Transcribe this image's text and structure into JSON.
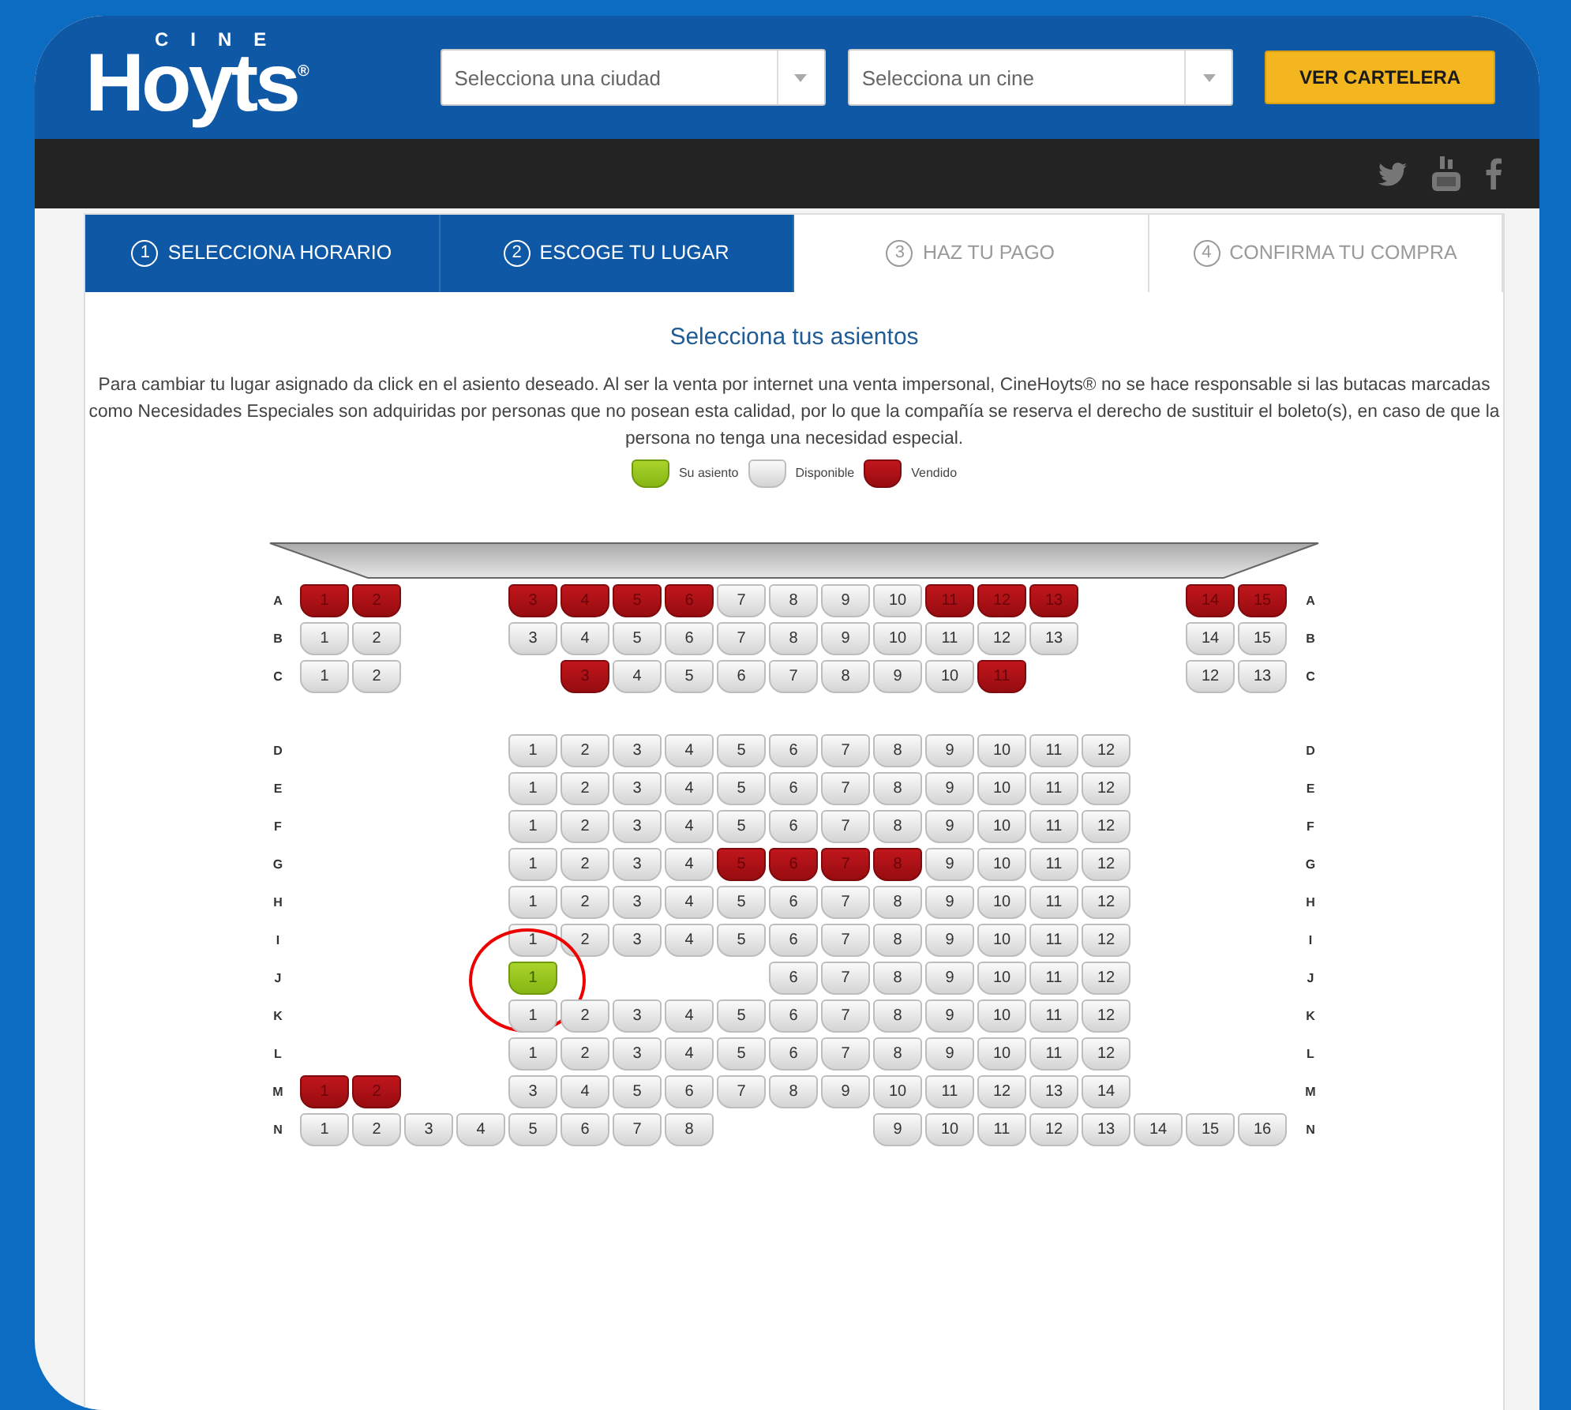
{
  "header": {
    "logo_small": "CINE",
    "logo": "Hoyts$^{®}$",
    "city_select": {
      "placeholder": "Selecciona una ciudad"
    },
    "cinema_select": {
      "placeholder": "Selecciona un cine"
    },
    "button": "VER CARTELERA"
  },
  "steps": [
    {
      "number": "1",
      "label": "SELECCIONA HORARIO",
      "disabled": false
    },
    {
      "number": "2",
      "label": "ESCOGE TU LUGAR",
      "disabled": false
    },
    {
      "number": "3",
      "label": "HAZ TU PAGO",
      "disabled": true
    },
    {
      "number": "4",
      "label": "CONFIRMA TU COMPRA",
      "disabled": true
    }
  ],
  "title": "Selecciona tus asientos",
  "notice": "Para cambiar tu lugar asignado da click en el asiento deseado. Al ser la venta por internet una venta impersonal, CineHoyts® no se hace responsable si las butacas marcadas como Necesidades Especiales son adquiridas por personas que no posean esta calidad, por lo que la compañía se reserva el derecho de sustituir el boleto(s), en caso de que la persona no tenga una necesidad especial.",
  "legend": [
    {
      "kind": "yours",
      "label": "Su asiento"
    },
    {
      "kind": "available",
      "label": "Disponible"
    },
    {
      "kind": "sold",
      "label": "Vendido"
    }
  ],
  "sections": [
    {
      "rows": [
        {
          "label_left": "A",
          "label_right": "A",
          "seats": [
            {
              "number": "1",
              "kind": "sold"
            },
            {
              "number": "2",
              "kind": "sold"
            },
            {
              "kind": "aisle"
            },
            {
              "kind": "aisle"
            },
            {
              "number": "3",
              "kind": "sold"
            },
            {
              "number": "4",
              "kind": "sold"
            },
            {
              "number": "5",
              "kind": "sold"
            },
            {
              "number": "6",
              "kind": "sold"
            },
            {
              "number": "7",
              "kind": "available"
            },
            {
              "number": "8",
              "kind": "available"
            },
            {
              "number": "9",
              "kind": "available"
            },
            {
              "number": "10",
              "kind": "available"
            },
            {
              "number": "11",
              "kind": "sold"
            },
            {
              "number": "12",
              "kind": "sold"
            },
            {
              "number": "13",
              "kind": "sold"
            },
            {
              "kind": "aisle"
            },
            {
              "kind": "aisle"
            },
            {
              "number": "14",
              "kind": "sold"
            },
            {
              "number": "15",
              "kind": "sold"
            }
          ]
        },
        {
          "label_left": "B",
          "label_right": "B",
          "seats": [
            {
              "number": "1",
              "kind": "available"
            },
            {
              "number": "2",
              "kind": "available"
            },
            {
              "kind": "aisle"
            },
            {
              "kind": "aisle"
            },
            {
              "number": "3",
              "kind": "available"
            },
            {
              "number": "4",
              "kind": "available"
            },
            {
              "number": "5",
              "kind": "available"
            },
            {
              "number": "6",
              "kind": "available"
            },
            {
              "number": "7",
              "kind": "available"
            },
            {
              "number": "8",
              "kind": "available"
            },
            {
              "number": "9",
              "kind": "available"
            },
            {
              "number": "10",
              "kind": "available"
            },
            {
              "number": "11",
              "kind": "available"
            },
            {
              "number": "12",
              "kind": "available"
            },
            {
              "number": "13",
              "kind": "available"
            },
            {
              "kind": "aisle"
            },
            {
              "kind": "aisle"
            },
            {
              "number": "14",
              "kind": "available"
            },
            {
              "number": "15",
              "kind": "available"
            }
          ]
        },
        {
          "label_left": "C",
          "label_right": "C",
          "seats": [
            {
              "number": "1",
              "kind": "available"
            },
            {
              "number": "2",
              "kind": "available"
            },
            {
              "kind": "aisle"
            },
            {
              "kind": "aisle"
            },
            {
              "kind": "aisle"
            },
            {
              "number": "3",
              "kind": "sold"
            },
            {
              "number": "4",
              "kind": "available"
            },
            {
              "number": "5",
              "kind": "available"
            },
            {
              "number": "6",
              "kind": "available"
            },
            {
              "number": "7",
              "kind": "available"
            },
            {
              "number": "8",
              "kind": "available"
            },
            {
              "number": "9",
              "kind": "available"
            },
            {
              "number": "10",
              "kind": "available"
            },
            {
              "number": "11",
              "kind": "sold"
            },
            {
              "kind": "aisle"
            },
            {
              "kind": "aisle"
            },
            {
              "kind": "aisle"
            },
            {
              "number": "12",
              "kind": "available"
            },
            {
              "number": "13",
              "kind": "available"
            }
          ]
        }
      ]
    },
    {
      "rows": [
        {
          "label_left": "D",
          "label_right": "D",
          "seats": [
            {
              "kind": "aisle"
            },
            {
              "kind": "aisle"
            },
            {
              "kind": "aisle"
            },
            {
              "kind": "aisle"
            },
            {
              "number": "1",
              "kind": "available"
            },
            {
              "number": "2",
              "kind": "available"
            },
            {
              "number": "3",
              "kind": "available"
            },
            {
              "number": "4",
              "kind": "available"
            },
            {
              "number": "5",
              "kind": "available"
            },
            {
              "number": "6",
              "kind": "available"
            },
            {
              "number": "7",
              "kind": "available"
            },
            {
              "number": "8",
              "kind": "available"
            },
            {
              "number": "9",
              "kind": "available"
            },
            {
              "number": "10",
              "kind": "available"
            },
            {
              "number": "11",
              "kind": "available"
            },
            {
              "number": "12",
              "kind": "available"
            }
          ]
        },
        {
          "label_left": "E",
          "label_right": "E",
          "seats": [
            {
              "kind": "aisle"
            },
            {
              "kind": "aisle"
            },
            {
              "kind": "aisle"
            },
            {
              "kind": "aisle"
            },
            {
              "number": "1",
              "kind": "available"
            },
            {
              "number": "2",
              "kind": "available"
            },
            {
              "number": "3",
              "kind": "available"
            },
            {
              "number": "4",
              "kind": "available"
            },
            {
              "number": "5",
              "kind": "available"
            },
            {
              "number": "6",
              "kind": "available"
            },
            {
              "number": "7",
              "kind": "available"
            },
            {
              "number": "8",
              "kind": "available"
            },
            {
              "number": "9",
              "kind": "available"
            },
            {
              "number": "10",
              "kind": "available"
            },
            {
              "number": "11",
              "kind": "available"
            },
            {
              "number": "12",
              "kind": "available"
            }
          ]
        },
        {
          "label_left": "F",
          "label_right": "F",
          "seats": [
            {
              "kind": "aisle"
            },
            {
              "kind": "aisle"
            },
            {
              "kind": "aisle"
            },
            {
              "kind": "aisle"
            },
            {
              "number": "1",
              "kind": "available"
            },
            {
              "number": "2",
              "kind": "available"
            },
            {
              "number": "3",
              "kind": "available"
            },
            {
              "number": "4",
              "kind": "available"
            },
            {
              "number": "5",
              "kind": "available"
            },
            {
              "number": "6",
              "kind": "available"
            },
            {
              "number": "7",
              "kind": "available"
            },
            {
              "number": "8",
              "kind": "available"
            },
            {
              "number": "9",
              "kind": "available"
            },
            {
              "number": "10",
              "kind": "available"
            },
            {
              "number": "11",
              "kind": "available"
            },
            {
              "number": "12",
              "kind": "available"
            }
          ]
        },
        {
          "label_left": "G",
          "label_right": "G",
          "seats": [
            {
              "kind": "aisle"
            },
            {
              "kind": "aisle"
            },
            {
              "kind": "aisle"
            },
            {
              "kind": "aisle"
            },
            {
              "number": "1",
              "kind": "available"
            },
            {
              "number": "2",
              "kind": "available"
            },
            {
              "number": "3",
              "kind": "available"
            },
            {
              "number": "4",
              "kind": "available"
            },
            {
              "number": "5",
              "kind": "sold"
            },
            {
              "number": "6",
              "kind": "sold"
            },
            {
              "number": "7",
              "kind": "sold"
            },
            {
              "number": "8",
              "kind": "sold"
            },
            {
              "number": "9",
              "kind": "available"
            },
            {
              "number": "10",
              "kind": "available"
            },
            {
              "number": "11",
              "kind": "available"
            },
            {
              "number": "12",
              "kind": "available"
            }
          ]
        },
        {
          "label_left": "H",
          "label_right": "H",
          "seats": [
            {
              "kind": "aisle"
            },
            {
              "kind": "aisle"
            },
            {
              "kind": "aisle"
            },
            {
              "kind": "aisle"
            },
            {
              "number": "1",
              "kind": "available"
            },
            {
              "number": "2",
              "kind": "available"
            },
            {
              "number": "3",
              "kind": "available"
            },
            {
              "number": "4",
              "kind": "available"
            },
            {
              "number": "5",
              "kind": "available"
            },
            {
              "number": "6",
              "kind": "available"
            },
            {
              "number": "7",
              "kind": "available"
            },
            {
              "number": "8",
              "kind": "available"
            },
            {
              "number": "9",
              "kind": "available"
            },
            {
              "number": "10",
              "kind": "available"
            },
            {
              "number": "11",
              "kind": "available"
            },
            {
              "number": "12",
              "kind": "available"
            }
          ]
        },
        {
          "label_left": "I",
          "label_right": "I",
          "seats": [
            {
              "kind": "aisle"
            },
            {
              "kind": "aisle"
            },
            {
              "kind": "aisle"
            },
            {
              "kind": "aisle"
            },
            {
              "number": "1",
              "kind": "available"
            },
            {
              "number": "2",
              "kind": "available"
            },
            {
              "number": "3",
              "kind": "available"
            },
            {
              "number": "4",
              "kind": "available"
            },
            {
              "number": "5",
              "kind": "available"
            },
            {
              "number": "6",
              "kind": "available"
            },
            {
              "number": "7",
              "kind": "available"
            },
            {
              "number": "8",
              "kind": "available"
            },
            {
              "number": "9",
              "kind": "available"
            },
            {
              "number": "10",
              "kind": "available"
            },
            {
              "number": "11",
              "kind": "available"
            },
            {
              "number": "12",
              "kind": "available"
            }
          ]
        },
        {
          "label_left": "J",
          "label_right": "J",
          "seats": [
            {
              "kind": "aisle"
            },
            {
              "kind": "aisle"
            },
            {
              "kind": "aisle"
            },
            {
              "kind": "aisle"
            },
            {
              "number": "1",
              "kind": "yours",
              "circled": true
            },
            {
              "kind": "aisle"
            },
            {
              "kind": "aisle"
            },
            {
              "kind": "aisle"
            },
            {
              "kind": "aisle"
            },
            {
              "number": "6",
              "kind": "available"
            },
            {
              "number": "7",
              "kind": "available"
            },
            {
              "number": "8",
              "kind": "available"
            },
            {
              "number": "9",
              "kind": "available"
            },
            {
              "number": "10",
              "kind": "available"
            },
            {
              "number": "11",
              "kind": "available"
            },
            {
              "number": "12",
              "kind": "available"
            }
          ]
        },
        {
          "label_left": "K",
          "label_right": "K",
          "seats": [
            {
              "kind": "aisle"
            },
            {
              "kind": "aisle"
            },
            {
              "kind": "aisle"
            },
            {
              "kind": "aisle"
            },
            {
              "number": "1",
              "kind": "available"
            },
            {
              "number": "2",
              "kind": "available"
            },
            {
              "number": "3",
              "kind": "available"
            },
            {
              "number": "4",
              "kind": "available"
            },
            {
              "number": "5",
              "kind": "available"
            },
            {
              "number": "6",
              "kind": "available"
            },
            {
              "number": "7",
              "kind": "available"
            },
            {
              "number": "8",
              "kind": "available"
            },
            {
              "number": "9",
              "kind": "available"
            },
            {
              "number": "10",
              "kind": "available"
            },
            {
              "number": "11",
              "kind": "available"
            },
            {
              "number": "12",
              "kind": "available"
            }
          ]
        },
        {
          "label_left": "L",
          "label_right": "L",
          "seats": [
            {
              "kind": "aisle"
            },
            {
              "kind": "aisle"
            },
            {
              "kind": "aisle"
            },
            {
              "kind": "aisle"
            },
            {
              "number": "1",
              "kind": "available"
            },
            {
              "number": "2",
              "kind": "available"
            },
            {
              "number": "3",
              "kind": "available"
            },
            {
              "number": "4",
              "kind": "available"
            },
            {
              "number": "5",
              "kind": "available"
            },
            {
              "number": "6",
              "kind": "available"
            },
            {
              "number": "7",
              "kind": "available"
            },
            {
              "number": "8",
              "kind": "available"
            },
            {
              "number": "9",
              "kind": "available"
            },
            {
              "number": "10",
              "kind": "available"
            },
            {
              "number": "11",
              "kind": "available"
            },
            {
              "number": "12",
              "kind": "available"
            }
          ]
        },
        {
          "label_left": "M",
          "label_right": "M",
          "seats": [
            {
              "number": "1",
              "kind": "sold"
            },
            {
              "number": "2",
              "kind": "sold"
            },
            {
              "kind": "aisle"
            },
            {
              "kind": "aisle"
            },
            {
              "number": "3",
              "kind": "available"
            },
            {
              "number": "4",
              "kind": "available"
            },
            {
              "number": "5",
              "kind": "available"
            },
            {
              "number": "6",
              "kind": "available"
            },
            {
              "number": "7",
              "kind": "available"
            },
            {
              "number": "8",
              "kind": "available"
            },
            {
              "number": "9",
              "kind": "available"
            },
            {
              "number": "10",
              "kind": "available"
            },
            {
              "number": "11",
              "kind": "available"
            },
            {
              "number": "12",
              "kind": "available"
            },
            {
              "number": "13",
              "kind": "available"
            },
            {
              "number": "14",
              "kind": "available"
            }
          ]
        },
        {
          "label_left": "N",
          "label_right": "N",
          "seats": [
            {
              "number": "1",
              "kind": "available"
            },
            {
              "number": "2",
              "kind": "available"
            },
            {
              "number": "3",
              "kind": "available"
            },
            {
              "number": "4",
              "kind": "available"
            },
            {
              "number": "5",
              "kind": "available"
            },
            {
              "number": "6",
              "kind": "available"
            },
            {
              "number": "7",
              "kind": "available"
            },
            {
              "number": "8",
              "kind": "available"
            },
            {
              "kind": "aisle"
            },
            {
              "kind": "aisle"
            },
            {
              "kind": "aisle"
            },
            {
              "number": "9",
              "kind": "available"
            },
            {
              "number": "10",
              "kind": "available"
            },
            {
              "number": "11",
              "kind": "available"
            },
            {
              "number": "12",
              "kind": "available"
            },
            {
              "number": "13",
              "kind": "available"
            },
            {
              "number": "14",
              "kind": "available"
            },
            {
              "number": "15",
              "kind": "available"
            },
            {
              "number": "16",
              "kind": "available"
            }
          ]
        }
      ]
    }
  ]
}
